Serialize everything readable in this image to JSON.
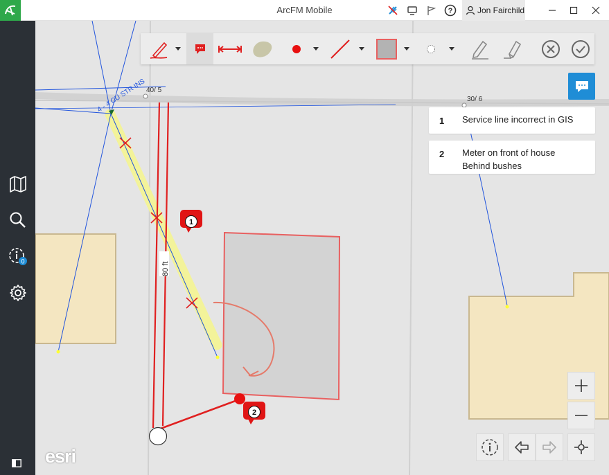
{
  "window": {
    "title": "ArcFM Mobile"
  },
  "user": {
    "name": "Jon Fairchild"
  },
  "sidebar": {
    "items": [
      {
        "name": "map",
        "icon": "map-icon"
      },
      {
        "name": "search",
        "icon": "search-icon"
      },
      {
        "name": "identify",
        "icon": "identify-icon",
        "badge": "0"
      },
      {
        "name": "settings",
        "icon": "gear-icon"
      }
    ]
  },
  "toolbar": {
    "tools": [
      "pen-tool",
      "comment-tool",
      "measure-tool",
      "area-fill-tool",
      "point-tool",
      "line-tool",
      "fill-color-tool",
      "outline-style-tool",
      "edit-tool",
      "eraser-tool",
      "cancel-button",
      "accept-button"
    ],
    "colors": {
      "pen": "#e02020",
      "point": "#e81010",
      "line": "#e02020",
      "fill": "#b3b3b3",
      "area": "#c8c6a8"
    }
  },
  "notes": [
    {
      "number": "1",
      "text_line1": "Service line incorrect in GIS",
      "text_line2": ""
    },
    {
      "number": "2",
      "text_line1": "Meter on front of house",
      "text_line2": "Behind bushes"
    }
  ],
  "map": {
    "labels": {
      "pole_left": "40/ 5",
      "pole_right": "30/ 6",
      "conductor": "4 - 4 CU STR INS",
      "measurement": "80 ft",
      "marker1": "1",
      "marker2": "2"
    },
    "colors": {
      "accent": "#1f8dd6",
      "sketch": "#e02020",
      "highlight": "#f3f39a",
      "building": "#f4e6c1",
      "lines": "#2255dd"
    }
  },
  "branding": {
    "esri": "esri"
  }
}
